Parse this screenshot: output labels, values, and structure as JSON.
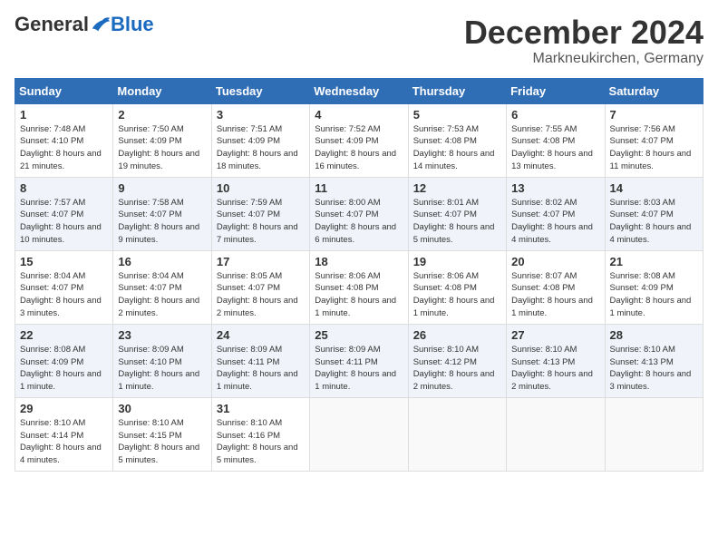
{
  "header": {
    "logo_general": "General",
    "logo_blue": "Blue",
    "month_title": "December 2024",
    "location": "Markneukirchen, Germany"
  },
  "weekdays": [
    "Sunday",
    "Monday",
    "Tuesday",
    "Wednesday",
    "Thursday",
    "Friday",
    "Saturday"
  ],
  "weeks": [
    [
      {
        "day": "1",
        "sunrise": "Sunrise: 7:48 AM",
        "sunset": "Sunset: 4:10 PM",
        "daylight": "Daylight: 8 hours and 21 minutes."
      },
      {
        "day": "2",
        "sunrise": "Sunrise: 7:50 AM",
        "sunset": "Sunset: 4:09 PM",
        "daylight": "Daylight: 8 hours and 19 minutes."
      },
      {
        "day": "3",
        "sunrise": "Sunrise: 7:51 AM",
        "sunset": "Sunset: 4:09 PM",
        "daylight": "Daylight: 8 hours and 18 minutes."
      },
      {
        "day": "4",
        "sunrise": "Sunrise: 7:52 AM",
        "sunset": "Sunset: 4:09 PM",
        "daylight": "Daylight: 8 hours and 16 minutes."
      },
      {
        "day": "5",
        "sunrise": "Sunrise: 7:53 AM",
        "sunset": "Sunset: 4:08 PM",
        "daylight": "Daylight: 8 hours and 14 minutes."
      },
      {
        "day": "6",
        "sunrise": "Sunrise: 7:55 AM",
        "sunset": "Sunset: 4:08 PM",
        "daylight": "Daylight: 8 hours and 13 minutes."
      },
      {
        "day": "7",
        "sunrise": "Sunrise: 7:56 AM",
        "sunset": "Sunset: 4:07 PM",
        "daylight": "Daylight: 8 hours and 11 minutes."
      }
    ],
    [
      {
        "day": "8",
        "sunrise": "Sunrise: 7:57 AM",
        "sunset": "Sunset: 4:07 PM",
        "daylight": "Daylight: 8 hours and 10 minutes."
      },
      {
        "day": "9",
        "sunrise": "Sunrise: 7:58 AM",
        "sunset": "Sunset: 4:07 PM",
        "daylight": "Daylight: 8 hours and 9 minutes."
      },
      {
        "day": "10",
        "sunrise": "Sunrise: 7:59 AM",
        "sunset": "Sunset: 4:07 PM",
        "daylight": "Daylight: 8 hours and 7 minutes."
      },
      {
        "day": "11",
        "sunrise": "Sunrise: 8:00 AM",
        "sunset": "Sunset: 4:07 PM",
        "daylight": "Daylight: 8 hours and 6 minutes."
      },
      {
        "day": "12",
        "sunrise": "Sunrise: 8:01 AM",
        "sunset": "Sunset: 4:07 PM",
        "daylight": "Daylight: 8 hours and 5 minutes."
      },
      {
        "day": "13",
        "sunrise": "Sunrise: 8:02 AM",
        "sunset": "Sunset: 4:07 PM",
        "daylight": "Daylight: 8 hours and 4 minutes."
      },
      {
        "day": "14",
        "sunrise": "Sunrise: 8:03 AM",
        "sunset": "Sunset: 4:07 PM",
        "daylight": "Daylight: 8 hours and 4 minutes."
      }
    ],
    [
      {
        "day": "15",
        "sunrise": "Sunrise: 8:04 AM",
        "sunset": "Sunset: 4:07 PM",
        "daylight": "Daylight: 8 hours and 3 minutes."
      },
      {
        "day": "16",
        "sunrise": "Sunrise: 8:04 AM",
        "sunset": "Sunset: 4:07 PM",
        "daylight": "Daylight: 8 hours and 2 minutes."
      },
      {
        "day": "17",
        "sunrise": "Sunrise: 8:05 AM",
        "sunset": "Sunset: 4:07 PM",
        "daylight": "Daylight: 8 hours and 2 minutes."
      },
      {
        "day": "18",
        "sunrise": "Sunrise: 8:06 AM",
        "sunset": "Sunset: 4:08 PM",
        "daylight": "Daylight: 8 hours and 1 minute."
      },
      {
        "day": "19",
        "sunrise": "Sunrise: 8:06 AM",
        "sunset": "Sunset: 4:08 PM",
        "daylight": "Daylight: 8 hours and 1 minute."
      },
      {
        "day": "20",
        "sunrise": "Sunrise: 8:07 AM",
        "sunset": "Sunset: 4:08 PM",
        "daylight": "Daylight: 8 hours and 1 minute."
      },
      {
        "day": "21",
        "sunrise": "Sunrise: 8:08 AM",
        "sunset": "Sunset: 4:09 PM",
        "daylight": "Daylight: 8 hours and 1 minute."
      }
    ],
    [
      {
        "day": "22",
        "sunrise": "Sunrise: 8:08 AM",
        "sunset": "Sunset: 4:09 PM",
        "daylight": "Daylight: 8 hours and 1 minute."
      },
      {
        "day": "23",
        "sunrise": "Sunrise: 8:09 AM",
        "sunset": "Sunset: 4:10 PM",
        "daylight": "Daylight: 8 hours and 1 minute."
      },
      {
        "day": "24",
        "sunrise": "Sunrise: 8:09 AM",
        "sunset": "Sunset: 4:11 PM",
        "daylight": "Daylight: 8 hours and 1 minute."
      },
      {
        "day": "25",
        "sunrise": "Sunrise: 8:09 AM",
        "sunset": "Sunset: 4:11 PM",
        "daylight": "Daylight: 8 hours and 1 minute."
      },
      {
        "day": "26",
        "sunrise": "Sunrise: 8:10 AM",
        "sunset": "Sunset: 4:12 PM",
        "daylight": "Daylight: 8 hours and 2 minutes."
      },
      {
        "day": "27",
        "sunrise": "Sunrise: 8:10 AM",
        "sunset": "Sunset: 4:13 PM",
        "daylight": "Daylight: 8 hours and 2 minutes."
      },
      {
        "day": "28",
        "sunrise": "Sunrise: 8:10 AM",
        "sunset": "Sunset: 4:13 PM",
        "daylight": "Daylight: 8 hours and 3 minutes."
      }
    ],
    [
      {
        "day": "29",
        "sunrise": "Sunrise: 8:10 AM",
        "sunset": "Sunset: 4:14 PM",
        "daylight": "Daylight: 8 hours and 4 minutes."
      },
      {
        "day": "30",
        "sunrise": "Sunrise: 8:10 AM",
        "sunset": "Sunset: 4:15 PM",
        "daylight": "Daylight: 8 hours and 5 minutes."
      },
      {
        "day": "31",
        "sunrise": "Sunrise: 8:10 AM",
        "sunset": "Sunset: 4:16 PM",
        "daylight": "Daylight: 8 hours and 5 minutes."
      },
      null,
      null,
      null,
      null
    ]
  ]
}
